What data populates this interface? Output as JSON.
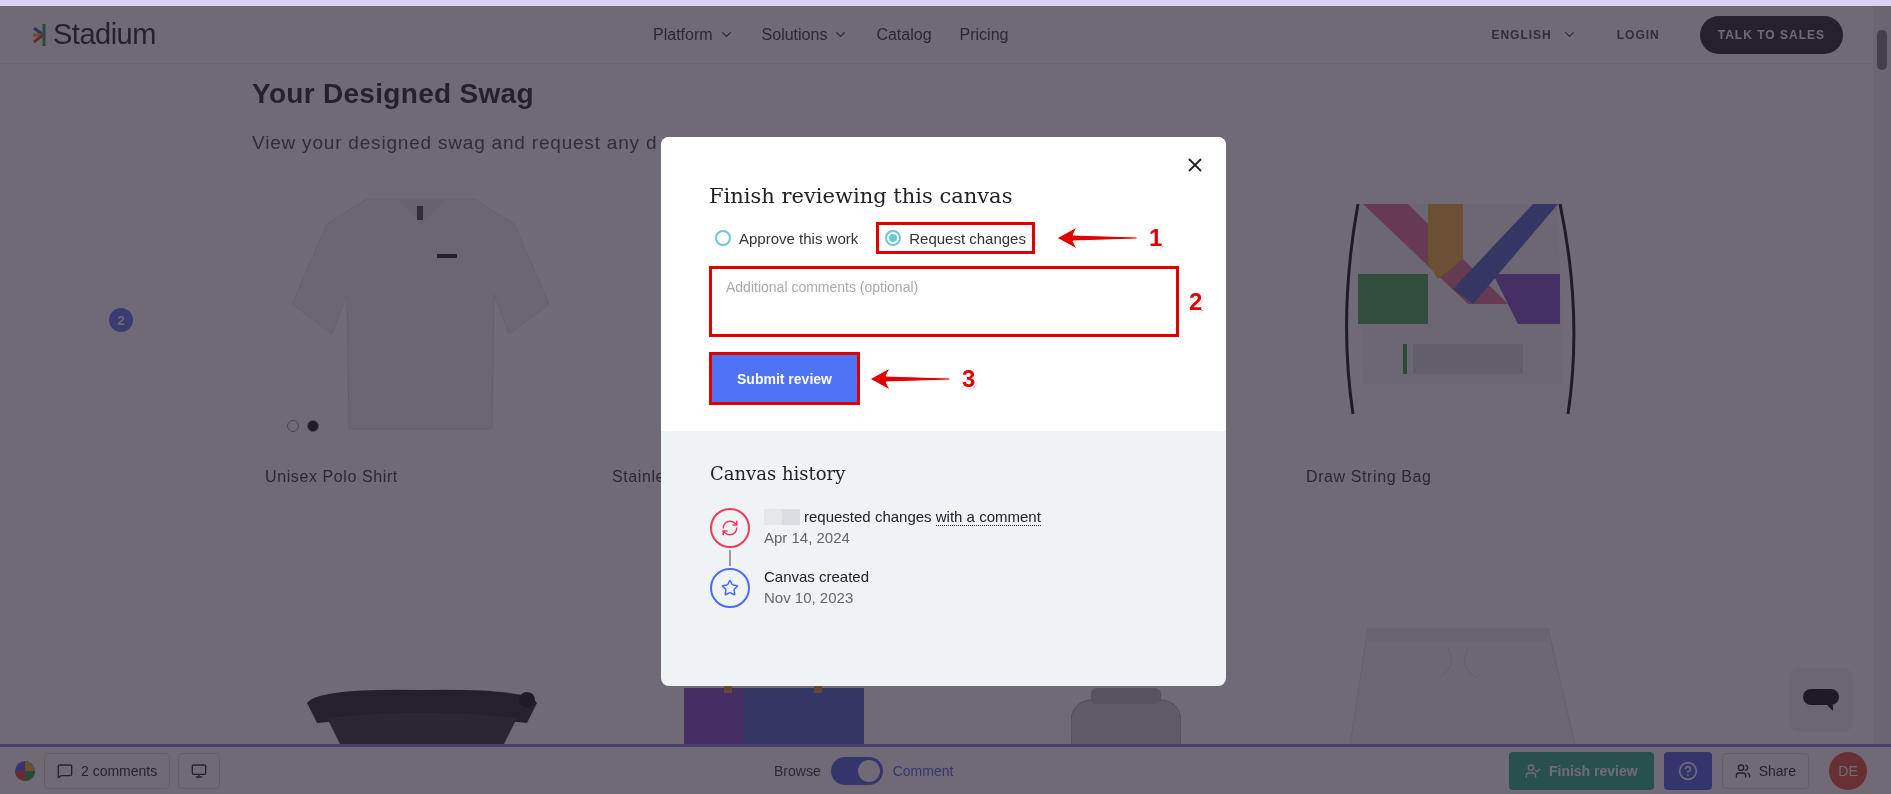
{
  "header": {
    "logo": "Stadium",
    "nav": [
      {
        "label": "Platform",
        "has_menu": true
      },
      {
        "label": "Solutions",
        "has_menu": true
      },
      {
        "label": "Catalog",
        "has_menu": false
      },
      {
        "label": "Pricing",
        "has_menu": false
      }
    ],
    "language": "ENGLISH",
    "login": "LOGIN",
    "cta": "TALK TO SALES"
  },
  "page": {
    "title": "Your Designed Swag",
    "subtitle": "View your designed swag and request any d",
    "comment_pin": "2",
    "products": [
      {
        "name": "Unisex Polo Shirt",
        "dots": [
          {
            "selected": false
          },
          {
            "selected": true
          }
        ]
      },
      {
        "name": "Stainle"
      },
      {
        "name": "Draw String Bag"
      }
    ]
  },
  "dialog": {
    "title": "Finish reviewing this canvas",
    "options": [
      {
        "label": "Approve this work",
        "selected": false
      },
      {
        "label": "Request changes",
        "selected": true
      }
    ],
    "comment": {
      "placeholder": "Additional comments (optional)"
    },
    "submit": "Submit review",
    "history": {
      "title": "Canvas history",
      "events": [
        {
          "kind": "changes",
          "redacted_name": true,
          "text": "requested changes",
          "link": "with a comment",
          "date": "Apr 14, 2024"
        },
        {
          "kind": "created",
          "text": "Canvas created",
          "date": "Nov 10, 2023"
        }
      ]
    },
    "annotations": [
      {
        "number": "1"
      },
      {
        "number": "2"
      },
      {
        "number": "3"
      }
    ]
  },
  "bottom_bar": {
    "comments": "2 comments",
    "browse": "Browse",
    "mode_toggle": {
      "on": true
    },
    "comment": "Comment",
    "finish": "Finish review",
    "share": "Share",
    "avatar": "DE"
  }
}
